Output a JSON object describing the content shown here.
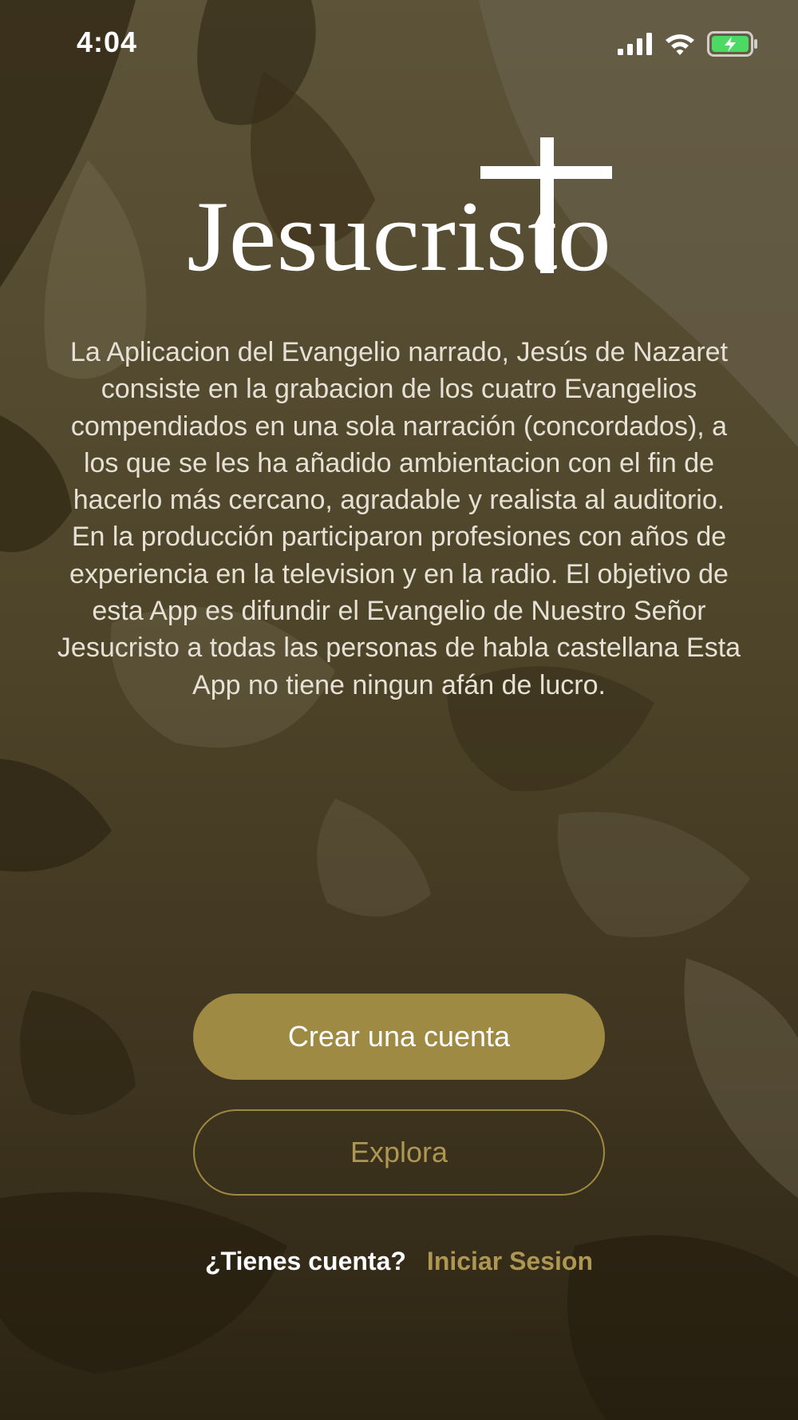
{
  "status_bar": {
    "time": "4:04",
    "icons": [
      "cellular-signal-icon",
      "wifi-icon",
      "battery-charging-icon"
    ]
  },
  "logo": {
    "text": "Jesucristo"
  },
  "intro": {
    "text": "La Aplicacion del Evangelio narrado, Jesús de Nazaret consiste en la grabacion de los cuatro Evangelios compendiados en una sola narración (concordados), a los que se les ha añadido ambientacion con el fin de hacerlo más cercano, agradable y realista al auditorio. En la producción participaron profesiones con años de experiencia en la television y en la radio. El objetivo de esta App es difundir el Evangelio de Nuestro Señor Jesucristo a todas las personas de habla castellana Esta App no tiene ningun afán de lucro."
  },
  "buttons": {
    "create_account": "Crear una cuenta",
    "explore": "Explora"
  },
  "login": {
    "question": "¿Tienes cuenta?",
    "link": "Iniciar Sesion"
  },
  "colors": {
    "accent": "#9e8a43",
    "accent_text": "#ad9752",
    "background": "#3f3520",
    "battery_fill": "#4cd964"
  }
}
